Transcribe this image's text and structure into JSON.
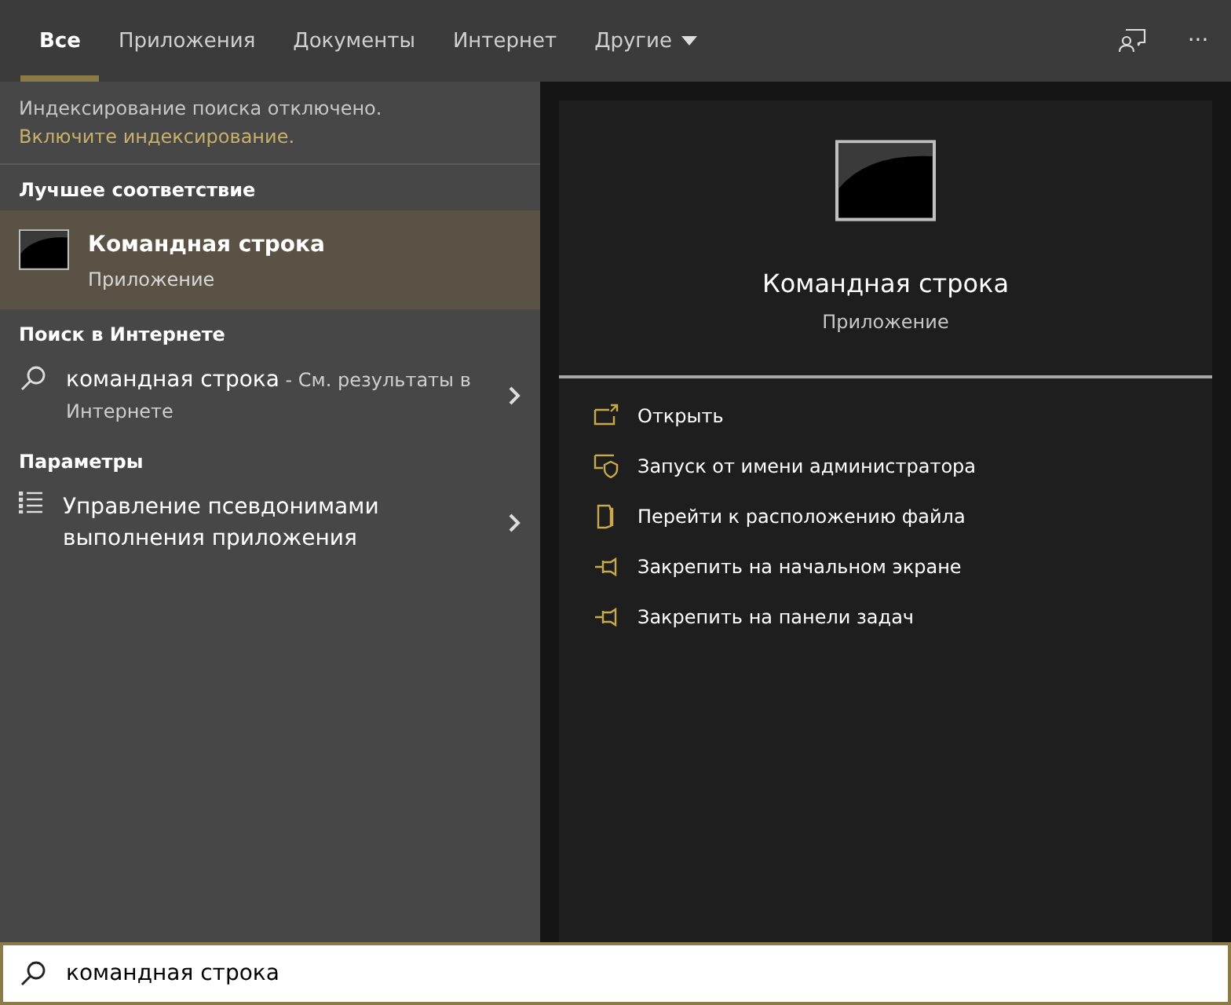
{
  "tabs": [
    {
      "label": "Все",
      "selected": true
    },
    {
      "label": "Приложения",
      "selected": false
    },
    {
      "label": "Документы",
      "selected": false
    },
    {
      "label": "Интернет",
      "selected": false
    },
    {
      "label": "Другие",
      "selected": false,
      "dropdown": true
    }
  ],
  "toolbar": {
    "more": "···"
  },
  "notice": {
    "text": "Индексирование поиска отключено.",
    "link": "Включите индексирование."
  },
  "sections": [
    {
      "title": "Лучшее соответствие",
      "items": [
        {
          "kind": "app",
          "title": "Командная строка",
          "subtitle": "Приложение",
          "selected": true
        }
      ]
    },
    {
      "title": "Поиск в Интернете",
      "items": [
        {
          "kind": "web",
          "query": "командная строка",
          "suffix": " - См. результаты в Интернете",
          "selected": false
        }
      ]
    },
    {
      "title": "Параметры",
      "items": [
        {
          "kind": "setting",
          "title": "Управление псевдонимами выполнения приложения",
          "selected": false
        }
      ]
    }
  ],
  "preview": {
    "title": "Командная строка",
    "subtitle": "Приложение",
    "actions": [
      {
        "kind": "open",
        "label": "Открыть"
      },
      {
        "kind": "admin",
        "label": "Запуск от имени администратора"
      },
      {
        "kind": "folder",
        "label": "Перейти к расположению файла"
      },
      {
        "kind": "pin",
        "label": "Закрепить на начальном экране"
      },
      {
        "kind": "pin",
        "label": "Закрепить на панели задач"
      }
    ]
  },
  "search": {
    "value": "командная строка"
  }
}
